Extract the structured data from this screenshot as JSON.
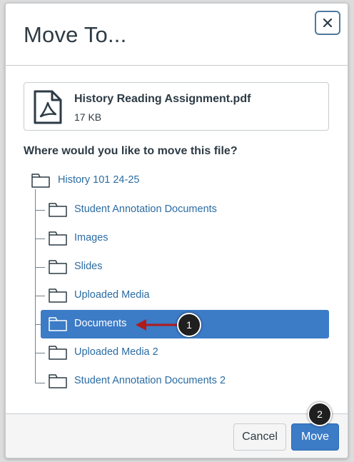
{
  "dialog": {
    "title": "Move To...",
    "close_icon": "close-icon"
  },
  "file": {
    "icon": "pdf-file-icon",
    "name": "History Reading Assignment.pdf",
    "size": "17 KB"
  },
  "question": "Where would you like to move this file?",
  "tree": {
    "root": {
      "label": "History 101 24-25",
      "icon": "folder-icon"
    },
    "children": [
      {
        "label": "Student Annotation Documents",
        "selected": false
      },
      {
        "label": "Images",
        "selected": false
      },
      {
        "label": "Slides",
        "selected": false
      },
      {
        "label": "Uploaded Media",
        "selected": false
      },
      {
        "label": "Documents",
        "selected": true
      },
      {
        "label": "Uploaded Media 2",
        "selected": false
      },
      {
        "label": "Student Annotation Documents 2",
        "selected": false
      }
    ]
  },
  "callouts": [
    "1",
    "2"
  ],
  "footer": {
    "cancel_label": "Cancel",
    "move_label": "Move"
  },
  "colors": {
    "accent": "#3c7bc6",
    "link": "#2b6ca3",
    "text": "#2d3b45",
    "callout_arrow": "#b01a1a"
  }
}
